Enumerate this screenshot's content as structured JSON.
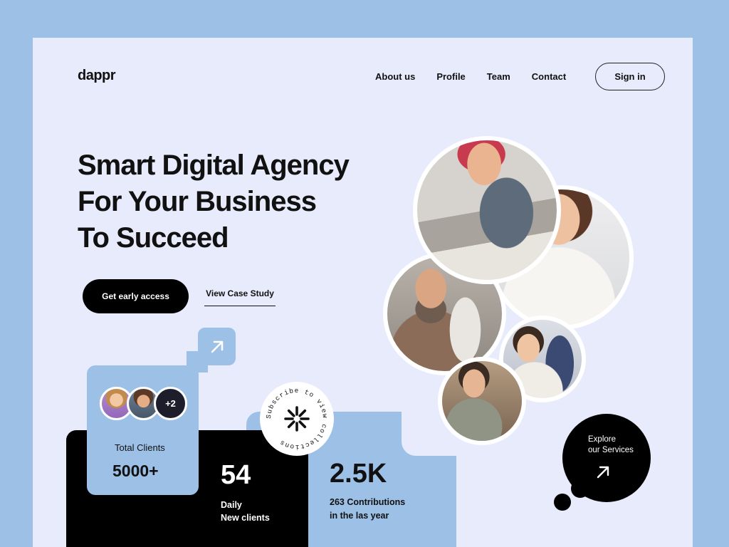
{
  "brand": {
    "logo": "dappr"
  },
  "nav": {
    "items": [
      "About us",
      "Profile",
      "Team",
      "Contact"
    ],
    "signin_label": "Sign in"
  },
  "hero": {
    "title_line1": "Smart Digital Agency",
    "title_line2": "For Your Business",
    "title_line3": "To Succeed",
    "cta_primary": "Get early access",
    "cta_secondary": "View Case Study"
  },
  "stats": {
    "clients": {
      "avatars_extra": "+2",
      "label": "Total Clients",
      "value": "5000+"
    },
    "daily": {
      "value": "54",
      "label_line1": "Daily",
      "label_line2": "New clients"
    },
    "contributions": {
      "value": "2.5K",
      "label_line1": "263 Contributions",
      "label_line2": "in the las year"
    }
  },
  "badge": {
    "circle_text": "Subscribe to view collections"
  },
  "explore": {
    "line1": "Explore",
    "line2": "our Services"
  },
  "colors": {
    "page_bg": "#e7ebfb",
    "outer_bg": "#9dc0e6",
    "accent_blue": "#9cc0e6",
    "dark": "#000000"
  },
  "icons": {
    "arrow": "arrow-up-right-icon",
    "asterisk": "asterisk-icon"
  }
}
